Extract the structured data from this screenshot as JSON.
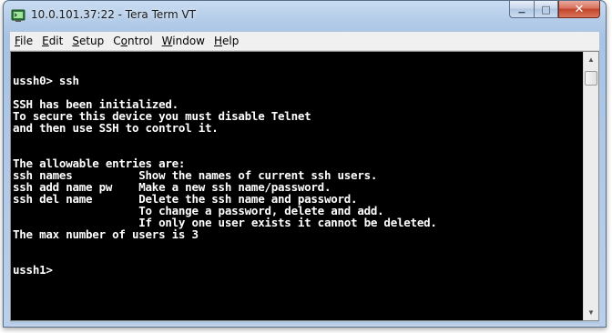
{
  "window": {
    "title": "10.0.101.37:22 - Tera Term VT",
    "minimize_glyph": "▁",
    "maximize_glyph": "□",
    "close_glyph": "✕"
  },
  "menu": [
    {
      "pre": "",
      "ul": "F",
      "post": "ile"
    },
    {
      "pre": "",
      "ul": "E",
      "post": "dit"
    },
    {
      "pre": "",
      "ul": "S",
      "post": "etup"
    },
    {
      "pre": "C",
      "ul": "o",
      "post": "ntrol"
    },
    {
      "pre": "",
      "ul": "W",
      "post": "indow"
    },
    {
      "pre": "",
      "ul": "H",
      "post": "elp"
    }
  ],
  "terminal": {
    "lines": [
      "",
      "ussh0> ssh",
      "",
      "SSH has been initialized.",
      "To secure this device you must disable Telnet",
      "and then use SSH to control it.",
      "",
      "",
      "The allowable entries are:",
      "ssh names          Show the names of current ssh users.",
      "ssh add name pw    Make a new ssh name/password.",
      "ssh del name       Delete the ssh name and password.",
      "                   To change a password, delete and add.",
      "                   If only one user exists it cannot be deleted.",
      "The max number of users is 3",
      "",
      "",
      "ussh1>"
    ]
  },
  "icons": {
    "app": "tera-term-icon",
    "scroll_up": "▲",
    "scroll_down": "▼"
  }
}
